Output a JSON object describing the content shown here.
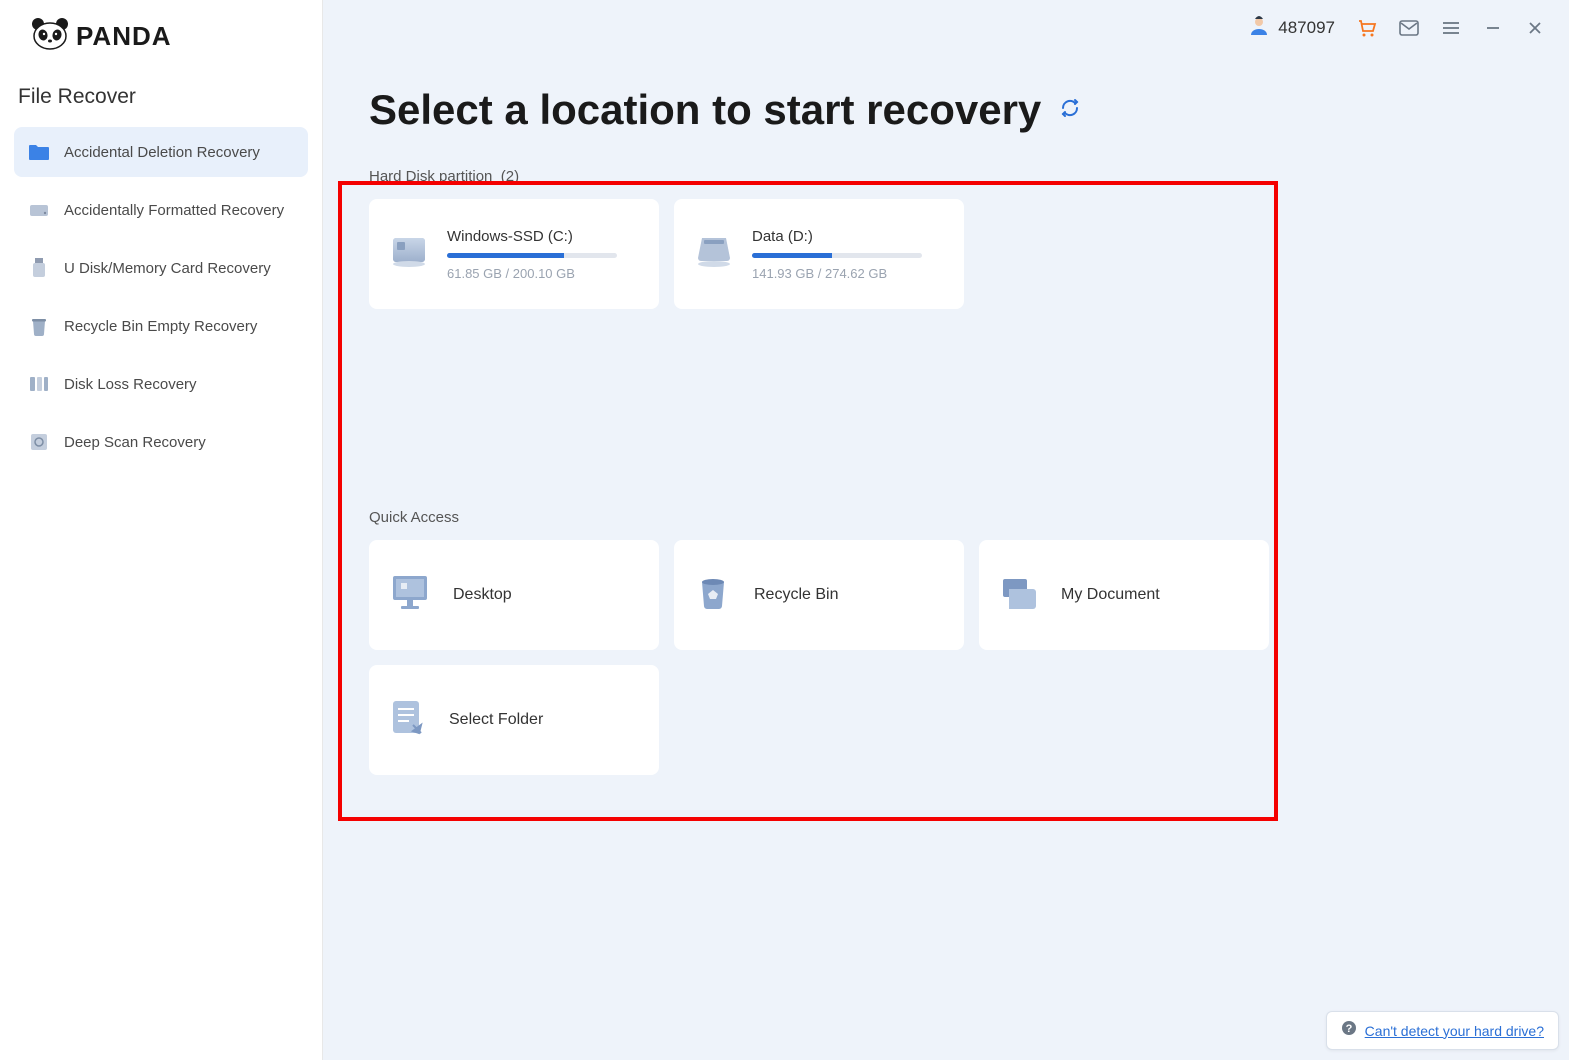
{
  "brand": "PANDA",
  "sidebar": {
    "title": "File Recover",
    "items": [
      {
        "label": "Accidental Deletion Recovery",
        "active": true
      },
      {
        "label": "Accidentally Formatted Recovery",
        "active": false
      },
      {
        "label": "U Disk/Memory Card Recovery",
        "active": false
      },
      {
        "label": "Recycle Bin Empty Recovery",
        "active": false
      },
      {
        "label": "Disk Loss Recovery",
        "active": false
      },
      {
        "label": "Deep Scan Recovery",
        "active": false
      }
    ]
  },
  "topbar": {
    "user_id": "487097"
  },
  "main": {
    "title": "Select a location to start recovery",
    "partition_label": "Hard Disk partition",
    "partition_count": "(2)",
    "partitions": [
      {
        "name": "Windows-SSD   (C:)",
        "used": "61.85 GB",
        "total": "200.10 GB",
        "size_text": "61.85 GB / 200.10 GB",
        "fill_pct": 69
      },
      {
        "name": "Data   (D:)",
        "used": "141.93 GB",
        "total": "274.62 GB",
        "size_text": "141.93 GB / 274.62 GB",
        "fill_pct": 47
      }
    ],
    "quick_label": "Quick Access",
    "quick": [
      {
        "label": "Desktop"
      },
      {
        "label": "Recycle Bin"
      },
      {
        "label": "My Document"
      },
      {
        "label": "Select Folder"
      }
    ],
    "help_text": "Can't detect your hard drive?"
  }
}
